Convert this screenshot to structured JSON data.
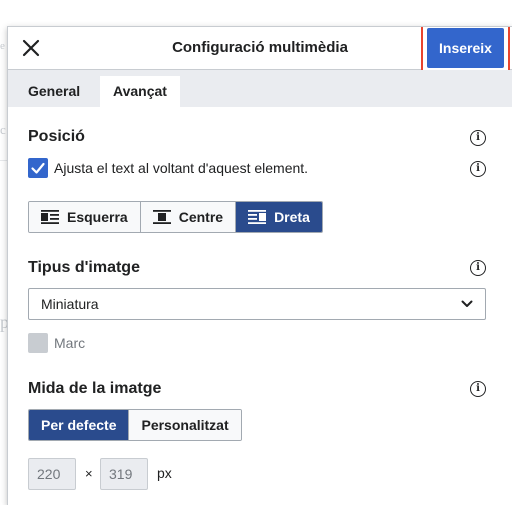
{
  "dialog": {
    "title": "Configuració multimèdia",
    "insert_label": "Insereix"
  },
  "tabs": [
    {
      "label": "General",
      "active": false
    },
    {
      "label": "Avançat",
      "active": true
    }
  ],
  "position": {
    "title": "Posició",
    "wrap_label": "Ajusta el text al voltant d'aquest element.",
    "wrap_checked": true,
    "align_options": [
      "Esquerra",
      "Centre",
      "Dreta"
    ],
    "align_selected": "Dreta"
  },
  "image_type": {
    "title": "Tipus d'imatge",
    "selected": "Miniatura",
    "frame_label": "Marc",
    "frame_checked": false
  },
  "image_size": {
    "title": "Mida de la imatge",
    "options": [
      "Per defecte",
      "Personalitzat"
    ],
    "selected": "Per defecte",
    "width": "220",
    "height": "319",
    "separator": "×",
    "unit": "px"
  },
  "colors": {
    "accent": "#3366cc",
    "active_segment": "#2a4b8d",
    "highlight_border": "#e8442e"
  }
}
